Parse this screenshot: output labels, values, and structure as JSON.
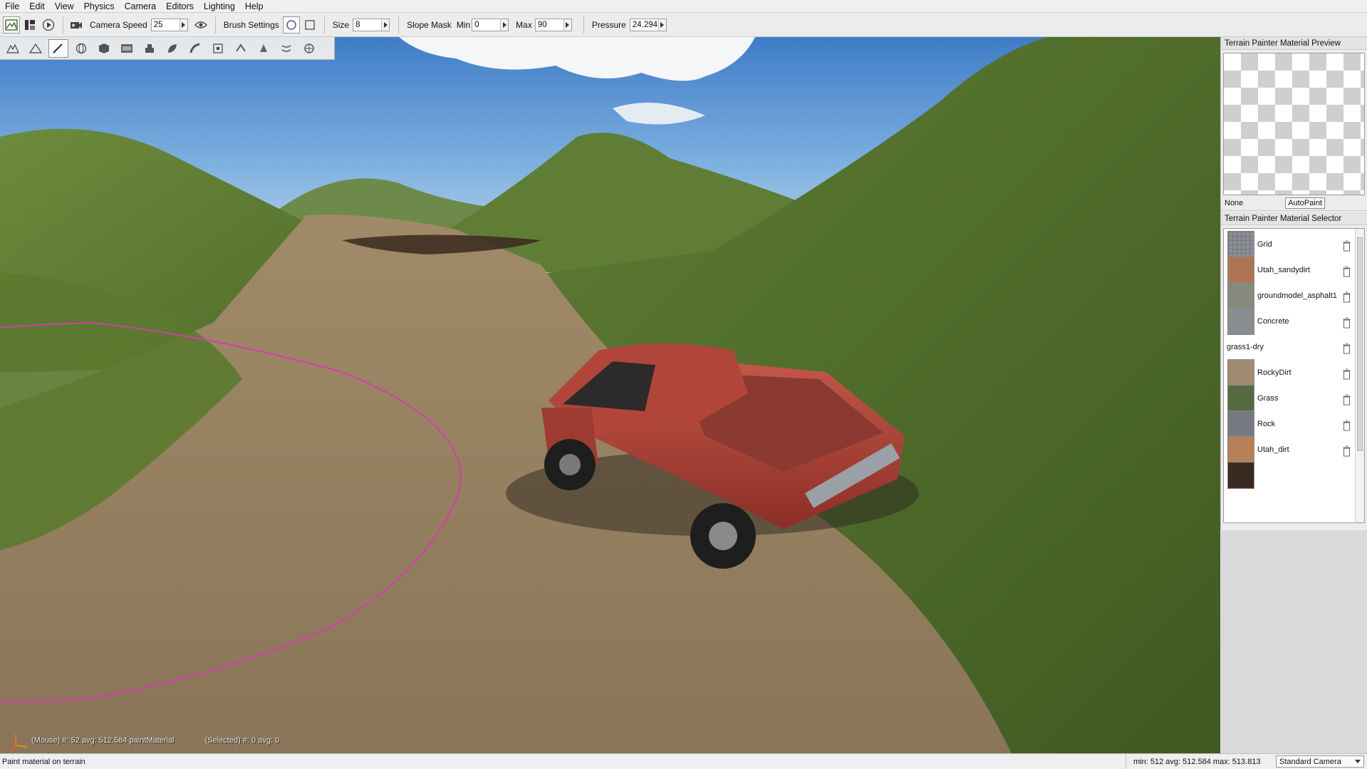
{
  "menu": [
    "File",
    "Edit",
    "View",
    "Physics",
    "Camera",
    "Editors",
    "Lighting",
    "Help"
  ],
  "toolbar": {
    "camera_speed_label": "Camera Speed",
    "camera_speed_value": "25",
    "brush_settings_label": "Brush Settings",
    "size_label": "Size",
    "size_value": "8",
    "slope_mask_label": "Slope Mask",
    "min_label": "Min",
    "min_value": "0",
    "max_label": "Max",
    "max_value": "90",
    "pressure_label": "Pressure",
    "pressure_value": "24.294"
  },
  "preview_panel": {
    "title": "Terrain Painter Material Preview",
    "selected_material": "None",
    "autopaint_label": "AutoPaint"
  },
  "selector_panel": {
    "title": "Terrain Painter Material Selector",
    "materials": [
      {
        "name": "Grid",
        "color": "#8b8f96"
      },
      {
        "name": "Utah_sandydirt",
        "color": "#b07452"
      },
      {
        "name": "groundmodel_asphalt1",
        "color": "#858a7c"
      },
      {
        "name": "Concrete",
        "color": "#8a8d91"
      },
      {
        "name": "grass1-dry",
        "color": ""
      },
      {
        "name": "RockyDirt",
        "color": "#a08a70"
      },
      {
        "name": "Grass",
        "color": "#566a40"
      },
      {
        "name": "Rock",
        "color": "#767980"
      },
      {
        "name": "Utah_dirt",
        "color": "#b78058"
      },
      {
        "name": "",
        "color": "#3a2a22"
      }
    ]
  },
  "viewport": {
    "mouse_info": "(Mouse) #: 52  avg: 512.584 paintMaterial",
    "selected_info": "(Selected) #: 0  avg: 0"
  },
  "status": {
    "message": "Paint material on terrain",
    "stats": "min: 512  avg: 512.584  max: 513.813",
    "camera": "Standard Camera"
  }
}
